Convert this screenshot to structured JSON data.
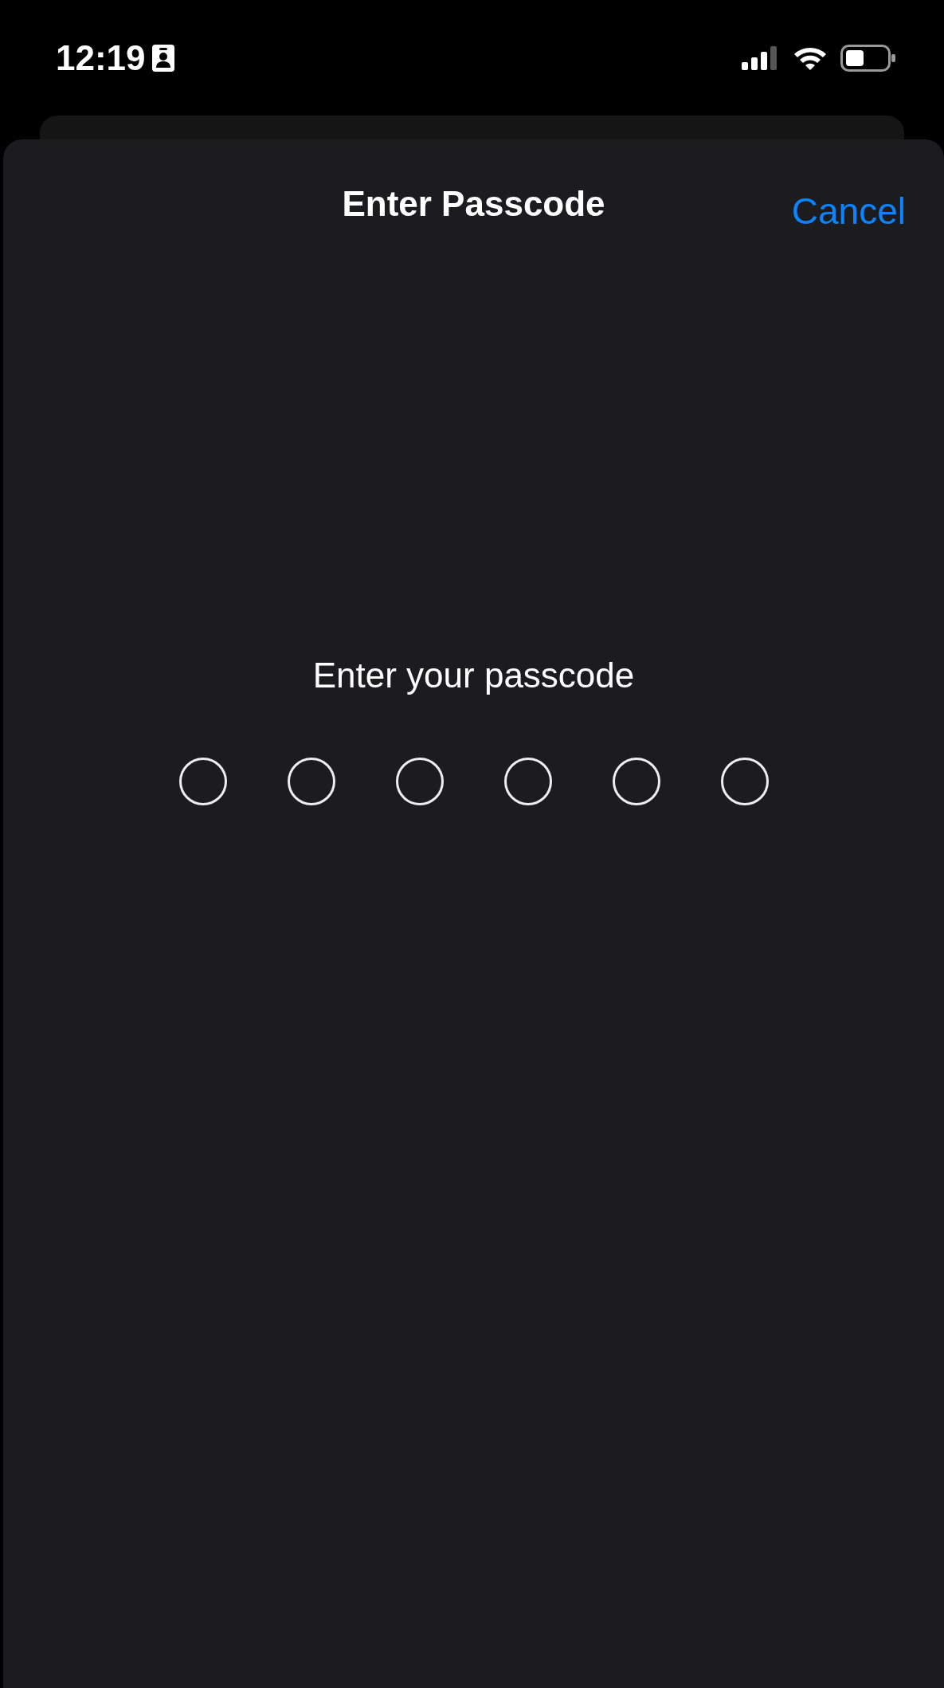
{
  "status_bar": {
    "time": "12:19"
  },
  "sheet": {
    "title": "Enter Passcode",
    "cancel": "Cancel"
  },
  "prompt": "Enter your passcode",
  "passcode_dots": [
    {
      "filled": false
    },
    {
      "filled": false
    },
    {
      "filled": false
    },
    {
      "filled": false
    },
    {
      "filled": false
    },
    {
      "filled": false
    }
  ]
}
